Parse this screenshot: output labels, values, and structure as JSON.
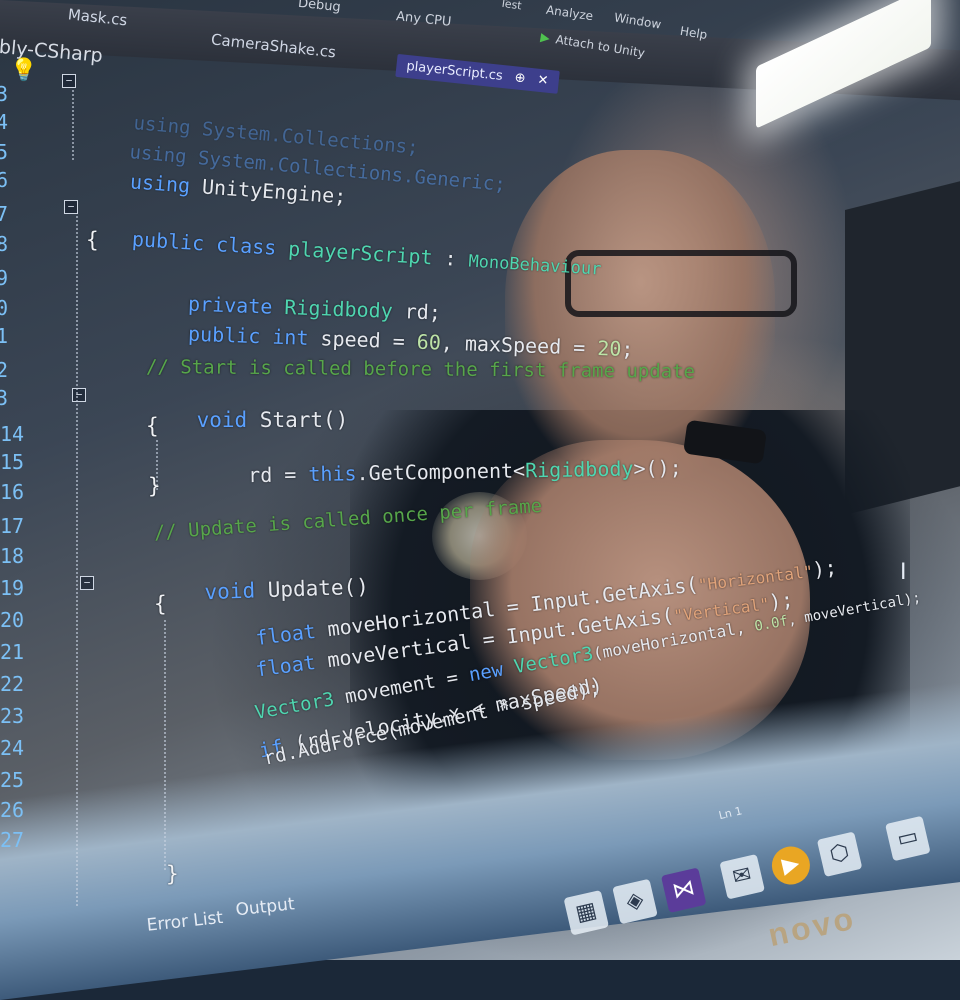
{
  "tabs": {
    "mask": "Mask.cs",
    "camera": "CameraShake.cs",
    "active": "playerScript.cs",
    "active_pin": "⊕",
    "active_close": "✕"
  },
  "menu": {
    "debug": "Debug",
    "cpu": "Any CPU",
    "test": "Test",
    "analyze": "Analyze",
    "window": "Window",
    "help": "Help",
    "attach": "Attach to Unity"
  },
  "solution": "bly-CSharp",
  "gutter": [
    "3",
    "4",
    "5",
    "6",
    "7",
    "8",
    "9",
    "0",
    "1",
    "2",
    "3",
    "14",
    "15",
    "16",
    "17",
    "18",
    "19",
    "20",
    "21",
    "22",
    "23",
    "24",
    "25",
    "26",
    "27"
  ],
  "code": {
    "l1": "using System.Collections;",
    "l2": "using System.Collections.Generic;",
    "l3_kw": "using",
    "l3_id": " UnityEngine;",
    "l5_kw": "public class",
    "l5_name": " playerScript",
    "l5_colon": " : ",
    "l5_base": "MonoBehaviour",
    "l6": "{",
    "l7_kw": "private",
    "l7_ty": " Rigidbody",
    "l7_id": " rd;",
    "l8_kw": "public int",
    "l8_id": " speed = ",
    "l8_n1": "60",
    "l8_id2": ", maxSpeed = ",
    "l8_n2": "20",
    "l8_end": ";",
    "l10": "// Start is called before the first frame update",
    "l11_kw": "void",
    "l11_id": " Start()",
    "l12": "{",
    "l13_id": "rd = ",
    "l13_kw": "this",
    "l13_id2": ".GetComponent<",
    "l13_ty": "Rigidbody",
    "l13_end": ">();",
    "l14": "}",
    "l16": "// Update is called once per frame",
    "l17_kw": "void",
    "l17_id": " Update()",
    "l18": "{",
    "l19_kw": "float",
    "l19_id": " moveHorizontal = Input.GetAxis(",
    "l19_st": "\"Horizontal\"",
    "l19_end": ");",
    "l20_kw": "float",
    "l20_id": " moveVertical = Input.GetAxis(",
    "l20_st": "\"Vertical\"",
    "l20_end": ");",
    "l22_ty": "Vector3",
    "l22_id": " movement = ",
    "l22_kw": "new",
    "l22_ty2": " Vector3",
    "l22_id2": "(moveHorizontal, ",
    "l22_nm": "0.0f",
    "l22_end": ", moveVertical);",
    "l23_kw": "if",
    "l23_id": " (rd.velocity.x < maxSpeed)",
    "l24_id": "rd.AddForce(movement * speed);",
    "l27": "}"
  },
  "bottom_tabs": {
    "error_list": "Error List",
    "output": "Output"
  },
  "status": {
    "ln": "Ln 1"
  },
  "brand": "novo",
  "colors": {
    "keyword": "#5aa0ff",
    "type": "#4fd6b0",
    "comment": "#57a64a",
    "string": "#e0a37a",
    "line_number": "#7cc0f5",
    "active_tab": "#3d3f8c"
  }
}
